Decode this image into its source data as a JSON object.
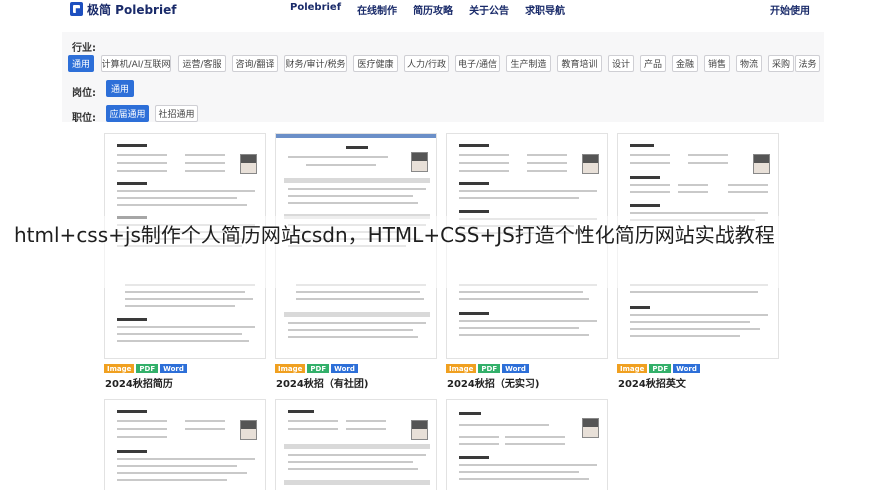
{
  "brand": {
    "logo_text": "极简 Polebrief"
  },
  "nav": {
    "items": [
      "Polebrief",
      "在线制作",
      "简历攻略",
      "关于公告",
      "求职导航"
    ],
    "start": "开始使用"
  },
  "filters": {
    "industry_label": "行业:",
    "industries": [
      "通用",
      "计算机/AI/互联网",
      "运营/客服",
      "咨询/翻译",
      "财务/审计/税务",
      "医疗健康",
      "人力/行政",
      "电子/通信",
      "生产制造",
      "教育培训",
      "设计",
      "产品",
      "金融",
      "销售",
      "物流",
      "采购",
      "法务"
    ],
    "position_label": "岗位:",
    "positions": [
      "通用"
    ],
    "stage_label": "职位:",
    "stages": [
      "应届通用",
      "社招通用"
    ]
  },
  "badges": {
    "image": "Image",
    "pdf": "PDF",
    "word": "Word"
  },
  "templates": [
    {
      "title": "2024秋招简历"
    },
    {
      "title": "2024秋招（有社团)"
    },
    {
      "title": "2024秋招（无实习)"
    },
    {
      "title": "2024秋招英文"
    }
  ],
  "overlay": {
    "text": "html+css+js制作个人简历网站csdn，HTML+CSS+JS打造个性化简历网站实战教程"
  },
  "colors": {
    "accent": "#2d6fd8",
    "brand": "#1a2b6a",
    "image_badge": "#f0a020",
    "pdf_badge": "#33b06a",
    "word_badge": "#2d6fd8"
  }
}
